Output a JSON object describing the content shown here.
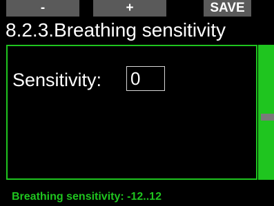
{
  "softkeys": {
    "minus_label": "-",
    "plus_label": "+",
    "save_label": "SAVE"
  },
  "screen": {
    "title": "8.2.3.Breathing sensitivity"
  },
  "setting": {
    "label": "Sensitivity:",
    "value": "0"
  },
  "status": {
    "text": "Breathing sensitivity: -12..12"
  },
  "colors": {
    "accent": "#1fc51f",
    "softkey_bg": "#5a5a5a",
    "background": "#000000"
  }
}
